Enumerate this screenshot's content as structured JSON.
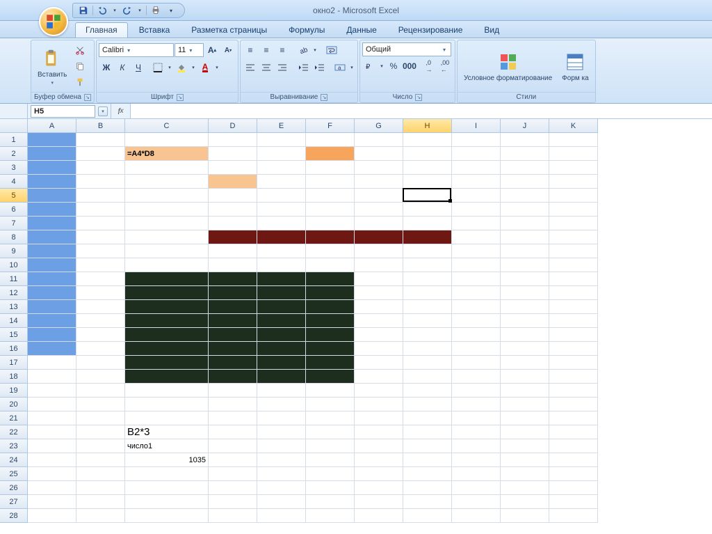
{
  "app": {
    "title": "окно2 - Microsoft Excel"
  },
  "qat_tooltip": {
    "save": "Сохранить",
    "undo": "Отменить",
    "redo": "Вернуть"
  },
  "tabs": [
    {
      "label": "Главная",
      "active": true
    },
    {
      "label": "Вставка",
      "active": false
    },
    {
      "label": "Разметка страницы",
      "active": false
    },
    {
      "label": "Формулы",
      "active": false
    },
    {
      "label": "Данные",
      "active": false
    },
    {
      "label": "Рецензирование",
      "active": false
    },
    {
      "label": "Вид",
      "active": false
    }
  ],
  "ribbon": {
    "clipboard": {
      "label": "Буфер обмена",
      "paste": "Вставить"
    },
    "font": {
      "label": "Шрифт",
      "name": "Calibri",
      "size": "11",
      "bold": "Ж",
      "italic": "К",
      "underline": "Ч"
    },
    "alignment": {
      "label": "Выравнивание"
    },
    "number": {
      "label": "Число",
      "format": "Общий"
    },
    "styles": {
      "label": "Стили",
      "cond_format": "Условное форматирование",
      "format_as": "Форм ка"
    }
  },
  "namebox": "H5",
  "formula_bar": "",
  "columns": [
    "A",
    "B",
    "C",
    "D",
    "E",
    "F",
    "G",
    "H",
    "I",
    "J",
    "K"
  ],
  "rows_count": 28,
  "selected_cell": {
    "col": "H",
    "row": 5
  },
  "cells": {
    "C2": {
      "value": "=A4*D8",
      "align": "left"
    },
    "C22": {
      "value": "B2*3",
      "align": "left"
    },
    "C23": {
      "value": "число1",
      "align": "left"
    },
    "C24": {
      "value": "1035",
      "align": "right"
    }
  },
  "fills": [
    {
      "range": "A1:A16",
      "color": "#6C9FE3"
    },
    {
      "range": "C2:C2",
      "color": "#F7C492"
    },
    {
      "range": "F2:F2",
      "color": "#F7A45C"
    },
    {
      "range": "D4:D4",
      "color": "#F7C492"
    },
    {
      "range": "D8:H8",
      "color": "#6E1813"
    },
    {
      "range": "C11:F18",
      "color": "#1E2E1E"
    }
  ],
  "col_widths": {
    "A": 70,
    "B": 70,
    "C": 120,
    "D": 70,
    "E": 70,
    "F": 70,
    "G": 70,
    "H": 70,
    "I": 70,
    "J": 70,
    "K": 70
  }
}
